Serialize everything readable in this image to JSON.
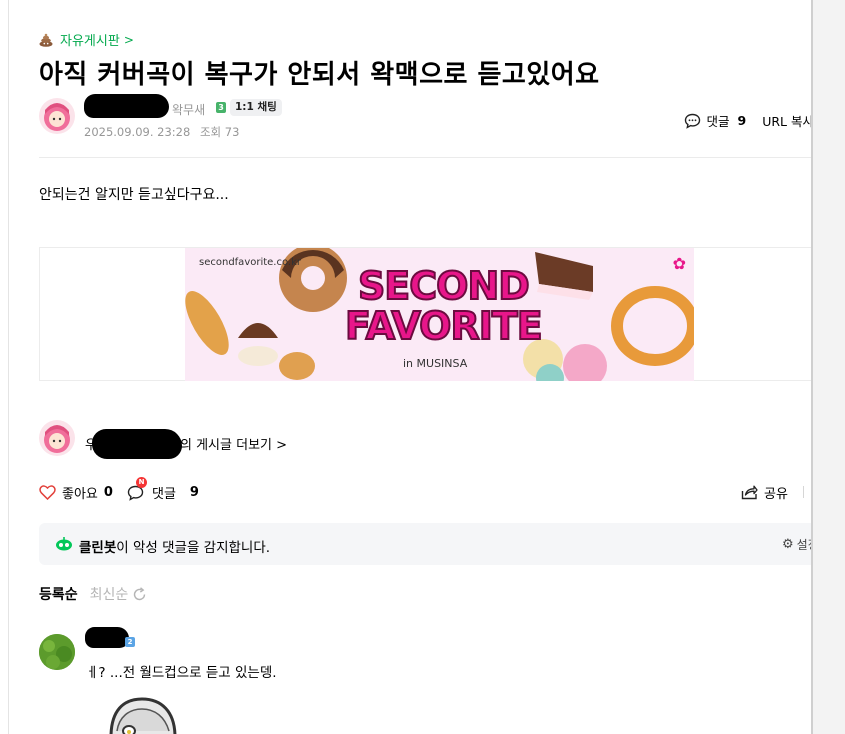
{
  "board": {
    "icon": "poo-icon",
    "name": "자유게시판",
    "chevron": ">"
  },
  "post": {
    "title": "아직 커버곡이 복구가 안되서 왁맥으로 듣고있어요",
    "author_grade_name": "왁무새",
    "author_grade_level": "3",
    "chat_label": "1:1 채팅",
    "date": "2025.09.09. 23:28",
    "views_label": "조회 73",
    "comment_label": "댓글",
    "comment_count": "9",
    "url_copy_label": "URL 복사",
    "body": "안되는건 알지만 듣고싶다구요..."
  },
  "banner": {
    "url": "secondfavorite.co.kr",
    "logo_line1": "SECOND",
    "logo_line2": "FAVORITE",
    "sub": "in MUSINSA",
    "brand_color": "#e8168a"
  },
  "author_more": {
    "prefix": "우",
    "suffix": "의 게시글 더보기 >"
  },
  "actions": {
    "like_label": "좋아요",
    "like_count": "0",
    "comment_label": "댓글",
    "comment_count": "9",
    "new_badge": "N",
    "share_label": "공유"
  },
  "cleanbot": {
    "name": "클린봇",
    "message": "이 악성 댓글을 감지합니다.",
    "setting_label": "설정"
  },
  "sort": {
    "active": "등록순",
    "inactive": "최신순"
  },
  "comments": [
    {
      "grade_level": "2",
      "text": "ㅔ? ...전 월드컵으로 듣고 있는뎅."
    }
  ],
  "colors": {
    "accent": "#03a94d",
    "like": "#e2403a",
    "new_badge": "#f53535"
  }
}
